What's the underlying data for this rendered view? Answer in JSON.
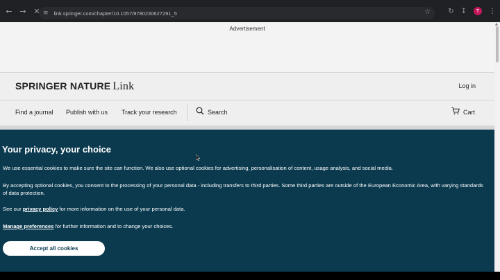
{
  "browser": {
    "url": "link.springer.com/chapter/10.1057/9780230627291_5",
    "profile_initial": "T",
    "icons": [
      "back-icon",
      "forward-icon",
      "stop-icon",
      "site-settings-icon",
      "star-icon",
      "history-icon",
      "download-icon",
      "menu-icon"
    ]
  },
  "ad": {
    "label": "Advertisement"
  },
  "header": {
    "brand_main": "SPRINGER NATURE",
    "brand_link": "Link",
    "login": "Log in"
  },
  "nav": {
    "find_journal": "Find a journal",
    "publish": "Publish with us",
    "track": "Track your research",
    "search": "Search",
    "cart": "Cart"
  },
  "cookie": {
    "title": "Your privacy, your choice",
    "p1": "We use essential cookies to make sure the site can function. We also use optional cookies for advertising, personalisation of content, usage analysis, and social media.",
    "p2": "By accepting optional cookies, you consent to the processing of your personal data - including transfers to third parties. Some third parties are outside of the European Economic Area, with varying standards of data protection.",
    "p3_before": "See our",
    "p3_link": "privacy policy",
    "p3_after": "for more information on the use of your personal data.",
    "p4_link": "Manage preferences",
    "p4_after": "for further information and to change your choices.",
    "accept": "Accept all cookies"
  },
  "colors": {
    "banner_bg": "#0b3a4f",
    "page_bg": "#f3f3f3",
    "chrome_bg": "#202124",
    "profile_bg": "#c2185b"
  }
}
